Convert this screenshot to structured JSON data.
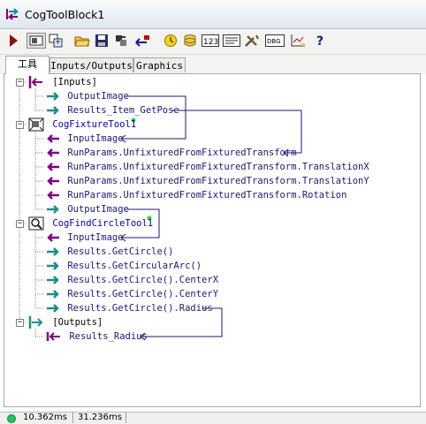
{
  "window": {
    "title": "CogToolBlock1"
  },
  "tabs": [
    {
      "label": "工具",
      "active": true
    },
    {
      "label": "Inputs/Outputs",
      "active": false
    },
    {
      "label": "Graphics",
      "active": false
    }
  ],
  "toolbar": {
    "buttons": [
      "run-icon",
      "display-icon",
      "tool-icon",
      "open-folder-icon",
      "save-icon",
      "copy-icon",
      "reset-icon",
      "clock-icon",
      "database-icon",
      "numbers-icon",
      "list-icon",
      "wrench-icon",
      "dbg-icon",
      "chart-icon",
      "help-icon"
    ]
  },
  "tree": {
    "inputs_label": "[Inputs]",
    "inputs": [
      {
        "label": "OutputImage"
      },
      {
        "label": "Results_Item_GetPose"
      }
    ],
    "fixture_tool": {
      "label": "CogFixtureTool1",
      "items": [
        {
          "label": "InputImage"
        },
        {
          "label": "RunParams.UnfixturedFromFixturedTransform"
        },
        {
          "label": "RunParams.UnfixturedFromFixturedTransform.TranslationX"
        },
        {
          "label": "RunParams.UnfixturedFromFixturedTransform.TranslationY"
        },
        {
          "label": "RunParams.UnfixturedFromFixturedTransform.Rotation"
        },
        {
          "label": "OutputImage"
        }
      ]
    },
    "circle_tool": {
      "label": "CogFindCircleTool1",
      "items": [
        {
          "label": "InputImage"
        },
        {
          "label": "Results.GetCircle()"
        },
        {
          "label": "Results.GetCircularArc()"
        },
        {
          "label": "Results.GetCircle().CenterX"
        },
        {
          "label": "Results.GetCircle().CenterY"
        },
        {
          "label": "Results.GetCircle().Radius"
        }
      ]
    },
    "outputs_label": "[Outputs]",
    "outputs": [
      {
        "label": "Results_Radius"
      }
    ]
  },
  "status": {
    "indicator_color": "#22c55e",
    "time1": "10.362ms",
    "time2": "31.236ms"
  },
  "colors": {
    "link": "#19197a",
    "tool_name": "#0000c0",
    "output_arrow": "#1f8c8c",
    "input_arrow": "#800080",
    "accent_green": "#22dd22"
  }
}
